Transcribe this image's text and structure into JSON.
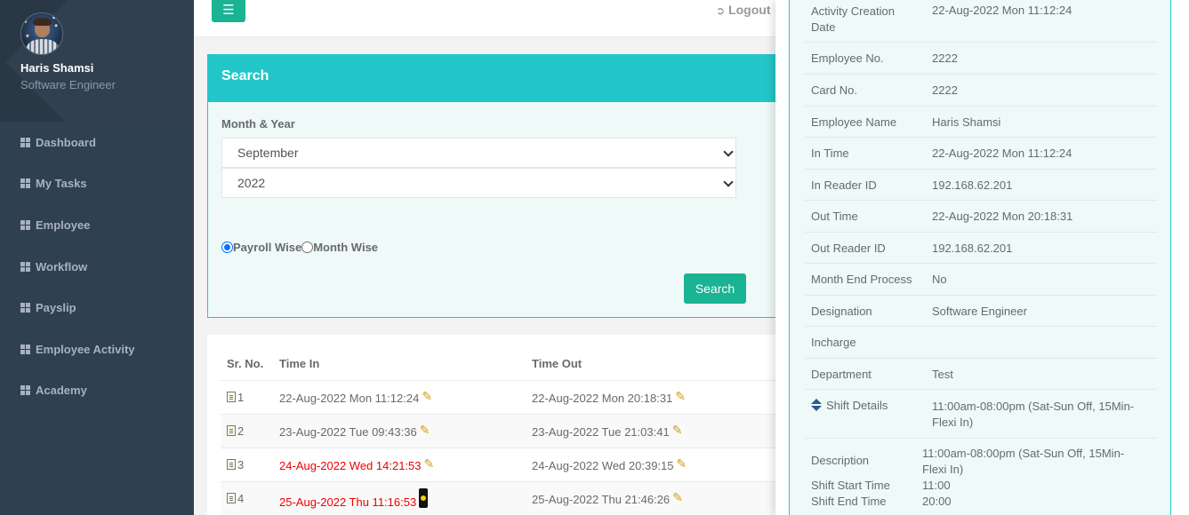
{
  "profile": {
    "name": "Haris Shamsi",
    "role": "Software Engineer"
  },
  "nav": [
    {
      "label": "Dashboard"
    },
    {
      "label": "My Tasks"
    },
    {
      "label": "Employee"
    },
    {
      "label": "Workflow"
    },
    {
      "label": "Payslip"
    },
    {
      "label": "Employee Activity"
    },
    {
      "label": "Academy"
    }
  ],
  "topbar": {
    "logout_label": "Logout"
  },
  "search": {
    "title": "Search",
    "month_year_label": "Month & Year",
    "month_value": "September",
    "year_value": "2022",
    "option_payroll": "Payroll Wise",
    "option_month": "Month Wise",
    "button_label": "Search"
  },
  "table": {
    "headers": {
      "sr": "Sr. No.",
      "time_in": "Time In",
      "time_out": "Time Out"
    },
    "rows": [
      {
        "sr": "1",
        "time_in": "22-Aug-2022 Mon 11:12:24",
        "time_out": "22-Aug-2022 Mon 20:18:31"
      },
      {
        "sr": "2",
        "time_in": "23-Aug-2022 Tue 09:43:36",
        "time_out": "23-Aug-2022 Tue 21:03:41"
      },
      {
        "sr": "3",
        "time_in": "24-Aug-2022 Wed 14:21:53",
        "time_out": "24-Aug-2022 Wed 20:39:15"
      },
      {
        "sr": "4",
        "time_in": "25-Aug-2022 Thu 11:16:53",
        "time_out": "25-Aug-2022 Thu 21:46:26"
      }
    ]
  },
  "detail": {
    "activity_creation_date": {
      "label1": "Activity Creation",
      "label2": "Date",
      "value": "22-Aug-2022 Mon 11:12:24"
    },
    "employee_no": {
      "label": "Employee No.",
      "value": "2222"
    },
    "card_no": {
      "label": "Card No.",
      "value": "2222"
    },
    "employee_name": {
      "label": "Employee Name",
      "value": "Haris Shamsi"
    },
    "in_time": {
      "label": "In Time",
      "value": "22-Aug-2022 Mon 11:12:24"
    },
    "in_reader_id": {
      "label": "In Reader ID",
      "value": "192.168.62.201"
    },
    "out_time": {
      "label": "Out Time",
      "value": "22-Aug-2022 Mon 20:18:31"
    },
    "out_reader_id": {
      "label": "Out Reader ID",
      "value": "192.168.62.201"
    },
    "month_end_process": {
      "label": "Month End Process",
      "value": "No"
    },
    "designation": {
      "label": "Designation",
      "value": "Software Engineer"
    },
    "incharge": {
      "label": "Incharge",
      "value": ""
    },
    "department": {
      "label": "Department",
      "value": "Test"
    },
    "shift_details": {
      "label": "Shift Details",
      "value1": "11:00am-08:00pm (Sat-Sun Off, 15Min-",
      "value2": "Flexi In)"
    },
    "description": {
      "label": "Description",
      "value1": "11:00am-08:00pm (Sat-Sun Off, 15Min-",
      "value2": "Flexi In)"
    },
    "shift_start_time": {
      "label": "Shift Start Time",
      "value": "11:00"
    },
    "shift_end_time": {
      "label": "Shift End Time",
      "value": "20:00"
    }
  }
}
